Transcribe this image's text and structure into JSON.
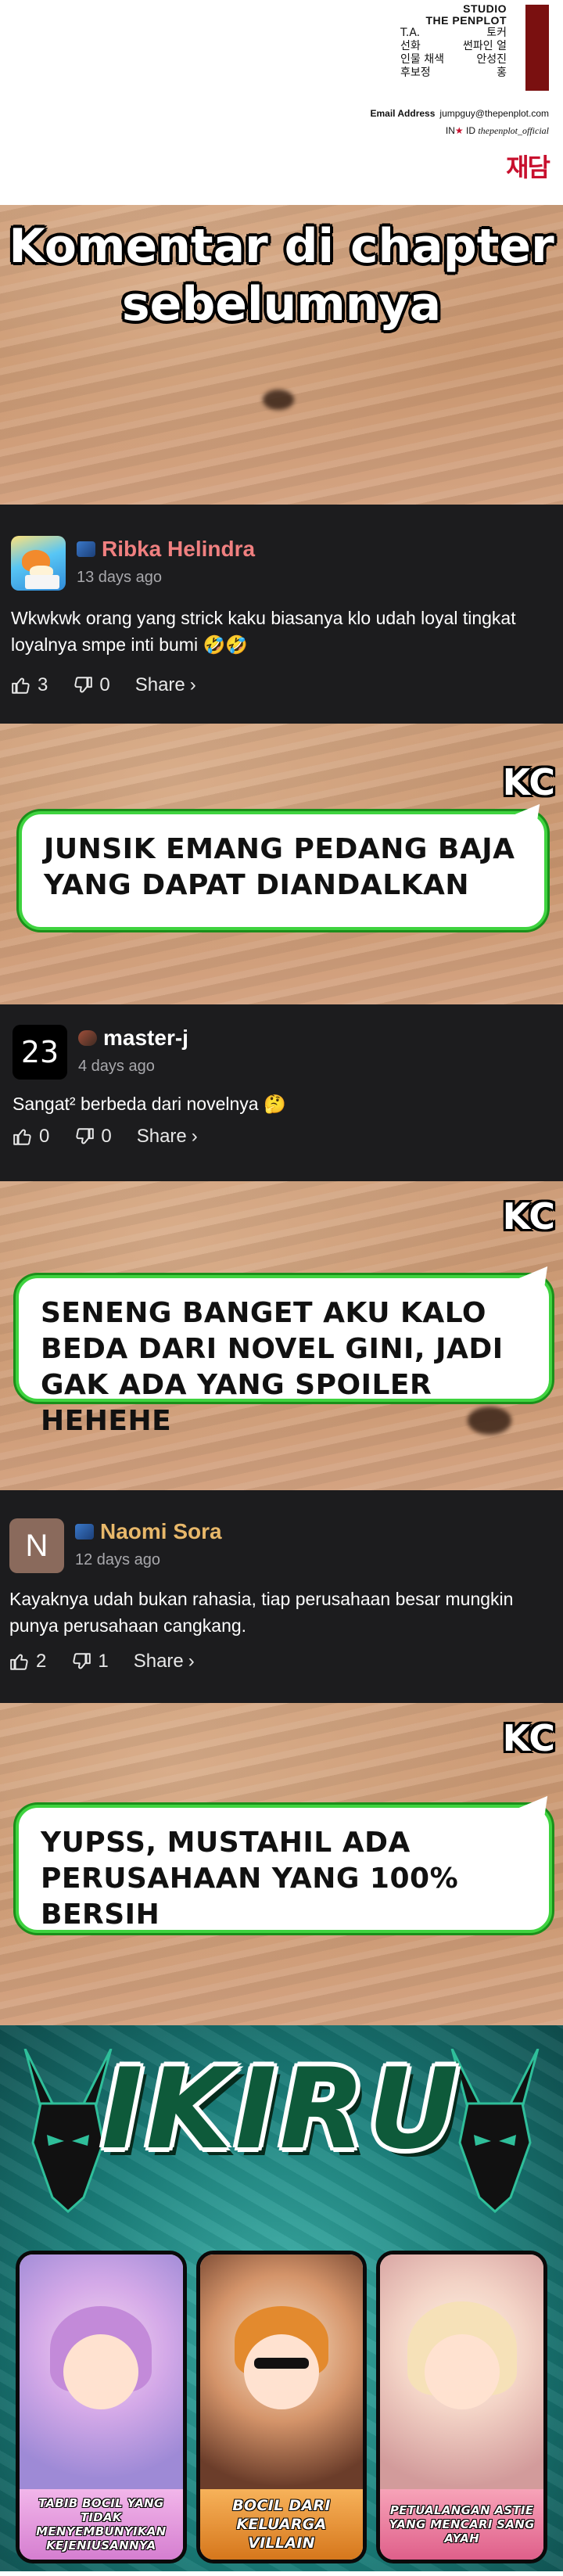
{
  "credits": {
    "studio": [
      "STUDIO",
      "THE PENPLOT"
    ],
    "roles": [
      {
        "role": "T.A.",
        "name": "토커"
      },
      {
        "role": "선화",
        "name": "썬파인 얼"
      },
      {
        "role": "인물 채색",
        "name": "안성진"
      },
      {
        "role": "후보정",
        "name": "홍"
      }
    ],
    "email_label": "Email Address",
    "email": "jumpguy@thepenplot.com",
    "ig_prefix": "IN",
    "ig_mid": "ID",
    "ig_handle": "thepenplot_official",
    "logo": "재담"
  },
  "title": {
    "line1": "Komentar di chapter",
    "line2": "sebelumnya"
  },
  "comments": [
    {
      "name": "Ribka Helindra",
      "time": "13 days ago",
      "body": "Wkwkwk orang yang strick kaku biasanya klo udah loyal tingkat loyalnya smpe inti bumi 🤣🤣",
      "likes": "3",
      "dislikes": "0",
      "share": "Share",
      "name_color": "#f08080"
    },
    {
      "name": "master-j",
      "avatar_text": "23",
      "time": "4 days ago",
      "body": "Sangat² berbeda dari novelnya 🤔",
      "likes": "0",
      "dislikes": "0",
      "share": "Share",
      "name_color": "#ffffff"
    },
    {
      "name": "Naomi Sora",
      "avatar_text": "N",
      "time": "12 days ago",
      "body": "Kayaknya udah bukan rahasia, tiap perusahaan besar mungkin punya perusahaan cangkang.",
      "likes": "2",
      "dislikes": "1",
      "share": "Share",
      "name_color": "#e8b86a"
    }
  ],
  "replies": [
    {
      "tag": "KC",
      "text": "JUNSIK EMANG PEDANG BAJA YANG DAPAT DIANDALKAN"
    },
    {
      "tag": "KC",
      "text": "SENENG BANGET AKU KALO BEDA DARI NOVEL GINI, JADI GAK ADA YANG SPOILER HEHEHE"
    },
    {
      "tag": "KC",
      "text": "YUPSS, MUSTAHIL ADA PERUSAHAAN YANG 100% BERSIH"
    }
  ],
  "ad": {
    "brand": "IKIRU",
    "cards": [
      {
        "caption": "TABIB BOCIL YANG TIDAK MENYEMBUNYIKAN KEJENIUSANNYA"
      },
      {
        "caption": "BOCIL DARI KELUARGA VILLAIN"
      },
      {
        "caption": "PETUALANGAN ASTIE YANG MENCARI SANG AYAH"
      }
    ]
  },
  "colors": {
    "comment_bg": "#1c1c1e",
    "bubble_border": "#3fd33f",
    "ad_teal": "#1a7e7a"
  }
}
